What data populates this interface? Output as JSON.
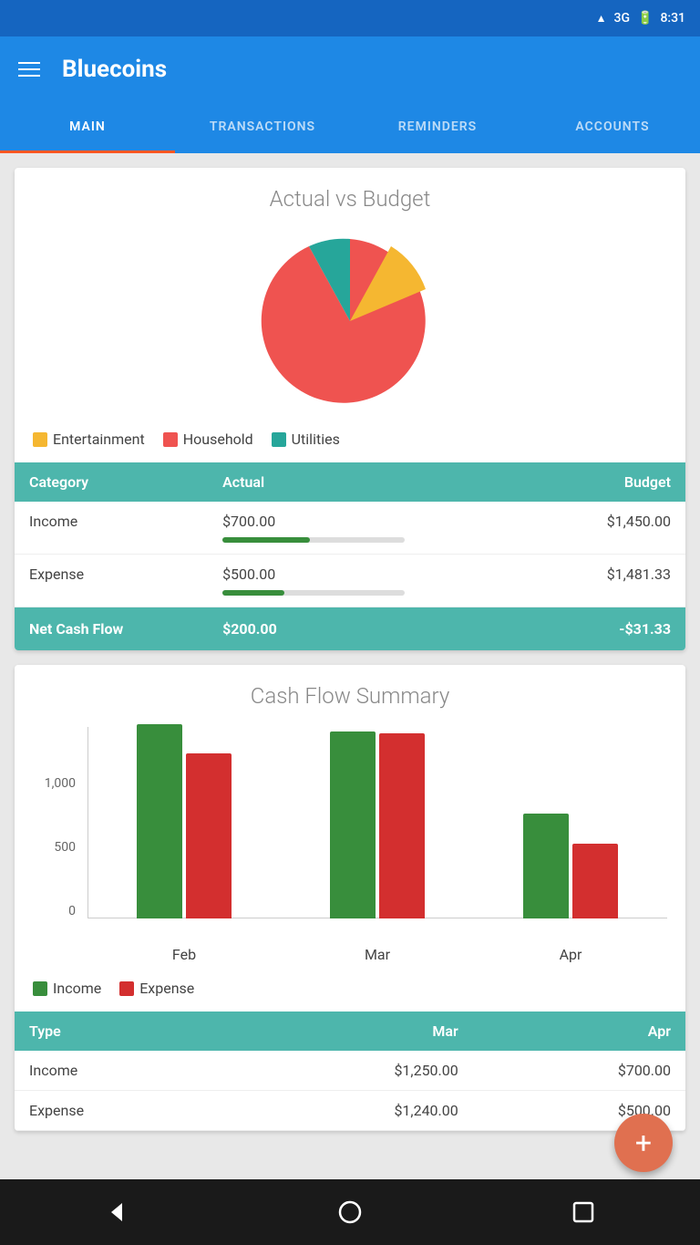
{
  "statusBar": {
    "network": "3G",
    "time": "8:31"
  },
  "appBar": {
    "title": "Bluecoins",
    "menuIcon": "hamburger-icon"
  },
  "tabs": [
    {
      "id": "main",
      "label": "MAIN",
      "active": true
    },
    {
      "id": "transactions",
      "label": "TRANSACTIONS",
      "active": false
    },
    {
      "id": "reminders",
      "label": "REMINDERS",
      "active": false
    },
    {
      "id": "accounts",
      "label": "ACCOUNTS",
      "active": false
    }
  ],
  "actualVsBudget": {
    "title": "Actual vs Budget",
    "legend": [
      {
        "label": "Entertainment",
        "color": "#F5B731"
      },
      {
        "label": "Household",
        "color": "#EF5350"
      },
      {
        "label": "Utilities",
        "color": "#26A69A"
      }
    ],
    "pieChart": {
      "segments": [
        {
          "label": "Household",
          "color": "#EF5350",
          "startAngle": -30,
          "endAngle": 270
        },
        {
          "label": "Utilities",
          "color": "#26A69A",
          "startAngle": -30,
          "endAngle": 30
        },
        {
          "label": "Entertainment",
          "color": "#F5B731",
          "startAngle": 30,
          "endAngle": 80
        }
      ]
    },
    "tableHeaders": [
      "Category",
      "Actual",
      "Budget"
    ],
    "tableRows": [
      {
        "category": "Income",
        "actual": "$700.00",
        "budget": "$1,450.00",
        "progressActual": 48,
        "progressBudget": 100,
        "barColorActual": "#388E3C"
      },
      {
        "category": "Expense",
        "actual": "$500.00",
        "budget": "$1,481.33",
        "progressActual": 34,
        "progressBudget": 100,
        "barColorActual": "#388E3C"
      }
    ],
    "footerLabel": "Net Cash Flow",
    "footerActual": "$200.00",
    "footerBudget": "-$31.33"
  },
  "cashFlowSummary": {
    "title": "Cash Flow Summary",
    "yLabels": [
      "1,000",
      "500",
      "0"
    ],
    "yMax": 1450,
    "months": [
      {
        "label": "Feb",
        "income": 1300,
        "expense": 1100
      },
      {
        "label": "Mar",
        "income": 1250,
        "expense": 1240
      },
      {
        "label": "Apr",
        "income": 700,
        "expense": 500
      }
    ],
    "legend": [
      {
        "label": "Income",
        "color": "#388E3C"
      },
      {
        "label": "Expense",
        "color": "#D32F2F"
      }
    ],
    "tableHeaders": [
      "Type",
      "Mar",
      "Apr"
    ],
    "tableRows": [
      {
        "type": "Income",
        "mar": "$1,250.00",
        "apr": "$700.00"
      },
      {
        "type": "Expense",
        "mar": "$1,240.00",
        "apr": "$500.00"
      }
    ]
  },
  "fab": {
    "icon": "+",
    "label": "Add transaction"
  },
  "bottomNav": {
    "back": "◁",
    "home": "○",
    "recent": "□"
  }
}
